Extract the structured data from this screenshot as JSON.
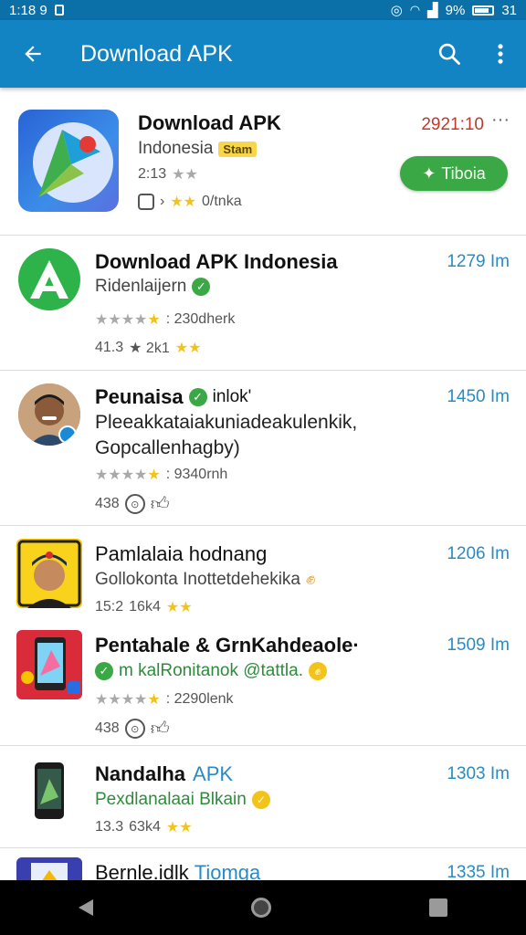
{
  "status_bar": {
    "time": "1:18 9",
    "battery": "9%",
    "extra": "31"
  },
  "app_bar": {
    "title": "Download APK"
  },
  "items": [
    {
      "name": "Download APK",
      "subtitle": "Indonesia",
      "badge": "Stam",
      "rating": "2:13",
      "meta": "0/tnka",
      "size": "2921:10",
      "button": "Tiboia"
    },
    {
      "name": "Download APK Indonesia",
      "subtitle": "Ridenlaijern",
      "rating_text": ": 230dherk",
      "meta_num": "41.3",
      "meta_text": "★ 2k1",
      "size": "1279 Im"
    },
    {
      "name": "Peunaisa",
      "name_suffix": "inlok'",
      "desc_line1": "Pleeakkataiakuniadeakulenkik,",
      "desc_line2": "Gopcallenhagby)",
      "rating_text": ": 9340rnh",
      "meta_num": "438",
      "size": "1450 Im"
    },
    {
      "name": "Pamlalaia hodnang",
      "subtitle": "Gollokonta Inottetdehekika",
      "meta_num": "15:2",
      "meta_text": "16k4",
      "size": "1206 Im"
    },
    {
      "name": "Pentahale & GrnKahdeaole·",
      "subtitle": "m kalRonitanok @tattla.",
      "rating_text": ": 2290lenk",
      "meta_num": "438",
      "size": "1509 Im"
    },
    {
      "name": "Nandalha",
      "name_suffix": "APK",
      "subtitle": "Pexdlanalaai Blkain",
      "meta_num": "13.3",
      "meta_text": "63k4",
      "size": "1303 Im"
    },
    {
      "name": "Bernle.idlk",
      "name_suffix": "Tiomga",
      "size": "1335 Im"
    }
  ],
  "colors": {
    "app_bar": "#1283c3",
    "status_bar": "#0b6fa8",
    "accent_green": "#3aa844",
    "size_blue": "#2a8bc4"
  }
}
